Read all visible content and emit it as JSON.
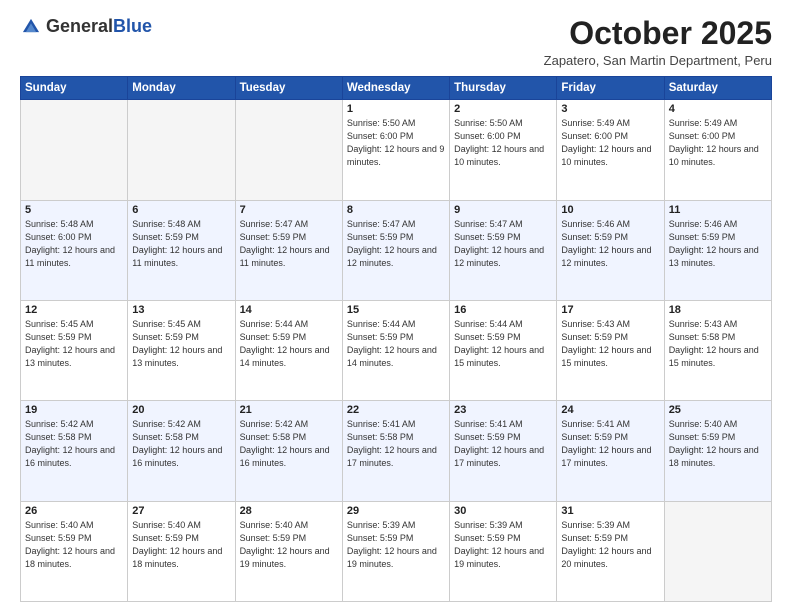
{
  "header": {
    "logo": {
      "general": "General",
      "blue": "Blue",
      "tagline": "General Blue"
    },
    "title": "October 2025",
    "subtitle": "Zapatero, San Martin Department, Peru"
  },
  "weekdays": [
    "Sunday",
    "Monday",
    "Tuesday",
    "Wednesday",
    "Thursday",
    "Friday",
    "Saturday"
  ],
  "weeks": [
    [
      {
        "day": null
      },
      {
        "day": null
      },
      {
        "day": null
      },
      {
        "day": "1",
        "sunrise": "Sunrise: 5:50 AM",
        "sunset": "Sunset: 6:00 PM",
        "daylight": "Daylight: 12 hours and 9 minutes."
      },
      {
        "day": "2",
        "sunrise": "Sunrise: 5:50 AM",
        "sunset": "Sunset: 6:00 PM",
        "daylight": "Daylight: 12 hours and 10 minutes."
      },
      {
        "day": "3",
        "sunrise": "Sunrise: 5:49 AM",
        "sunset": "Sunset: 6:00 PM",
        "daylight": "Daylight: 12 hours and 10 minutes."
      },
      {
        "day": "4",
        "sunrise": "Sunrise: 5:49 AM",
        "sunset": "Sunset: 6:00 PM",
        "daylight": "Daylight: 12 hours and 10 minutes."
      }
    ],
    [
      {
        "day": "5",
        "sunrise": "Sunrise: 5:48 AM",
        "sunset": "Sunset: 6:00 PM",
        "daylight": "Daylight: 12 hours and 11 minutes."
      },
      {
        "day": "6",
        "sunrise": "Sunrise: 5:48 AM",
        "sunset": "Sunset: 5:59 PM",
        "daylight": "Daylight: 12 hours and 11 minutes."
      },
      {
        "day": "7",
        "sunrise": "Sunrise: 5:47 AM",
        "sunset": "Sunset: 5:59 PM",
        "daylight": "Daylight: 12 hours and 11 minutes."
      },
      {
        "day": "8",
        "sunrise": "Sunrise: 5:47 AM",
        "sunset": "Sunset: 5:59 PM",
        "daylight": "Daylight: 12 hours and 12 minutes."
      },
      {
        "day": "9",
        "sunrise": "Sunrise: 5:47 AM",
        "sunset": "Sunset: 5:59 PM",
        "daylight": "Daylight: 12 hours and 12 minutes."
      },
      {
        "day": "10",
        "sunrise": "Sunrise: 5:46 AM",
        "sunset": "Sunset: 5:59 PM",
        "daylight": "Daylight: 12 hours and 12 minutes."
      },
      {
        "day": "11",
        "sunrise": "Sunrise: 5:46 AM",
        "sunset": "Sunset: 5:59 PM",
        "daylight": "Daylight: 12 hours and 13 minutes."
      }
    ],
    [
      {
        "day": "12",
        "sunrise": "Sunrise: 5:45 AM",
        "sunset": "Sunset: 5:59 PM",
        "daylight": "Daylight: 12 hours and 13 minutes."
      },
      {
        "day": "13",
        "sunrise": "Sunrise: 5:45 AM",
        "sunset": "Sunset: 5:59 PM",
        "daylight": "Daylight: 12 hours and 13 minutes."
      },
      {
        "day": "14",
        "sunrise": "Sunrise: 5:44 AM",
        "sunset": "Sunset: 5:59 PM",
        "daylight": "Daylight: 12 hours and 14 minutes."
      },
      {
        "day": "15",
        "sunrise": "Sunrise: 5:44 AM",
        "sunset": "Sunset: 5:59 PM",
        "daylight": "Daylight: 12 hours and 14 minutes."
      },
      {
        "day": "16",
        "sunrise": "Sunrise: 5:44 AM",
        "sunset": "Sunset: 5:59 PM",
        "daylight": "Daylight: 12 hours and 15 minutes."
      },
      {
        "day": "17",
        "sunrise": "Sunrise: 5:43 AM",
        "sunset": "Sunset: 5:59 PM",
        "daylight": "Daylight: 12 hours and 15 minutes."
      },
      {
        "day": "18",
        "sunrise": "Sunrise: 5:43 AM",
        "sunset": "Sunset: 5:58 PM",
        "daylight": "Daylight: 12 hours and 15 minutes."
      }
    ],
    [
      {
        "day": "19",
        "sunrise": "Sunrise: 5:42 AM",
        "sunset": "Sunset: 5:58 PM",
        "daylight": "Daylight: 12 hours and 16 minutes."
      },
      {
        "day": "20",
        "sunrise": "Sunrise: 5:42 AM",
        "sunset": "Sunset: 5:58 PM",
        "daylight": "Daylight: 12 hours and 16 minutes."
      },
      {
        "day": "21",
        "sunrise": "Sunrise: 5:42 AM",
        "sunset": "Sunset: 5:58 PM",
        "daylight": "Daylight: 12 hours and 16 minutes."
      },
      {
        "day": "22",
        "sunrise": "Sunrise: 5:41 AM",
        "sunset": "Sunset: 5:58 PM",
        "daylight": "Daylight: 12 hours and 17 minutes."
      },
      {
        "day": "23",
        "sunrise": "Sunrise: 5:41 AM",
        "sunset": "Sunset: 5:59 PM",
        "daylight": "Daylight: 12 hours and 17 minutes."
      },
      {
        "day": "24",
        "sunrise": "Sunrise: 5:41 AM",
        "sunset": "Sunset: 5:59 PM",
        "daylight": "Daylight: 12 hours and 17 minutes."
      },
      {
        "day": "25",
        "sunrise": "Sunrise: 5:40 AM",
        "sunset": "Sunset: 5:59 PM",
        "daylight": "Daylight: 12 hours and 18 minutes."
      }
    ],
    [
      {
        "day": "26",
        "sunrise": "Sunrise: 5:40 AM",
        "sunset": "Sunset: 5:59 PM",
        "daylight": "Daylight: 12 hours and 18 minutes."
      },
      {
        "day": "27",
        "sunrise": "Sunrise: 5:40 AM",
        "sunset": "Sunset: 5:59 PM",
        "daylight": "Daylight: 12 hours and 18 minutes."
      },
      {
        "day": "28",
        "sunrise": "Sunrise: 5:40 AM",
        "sunset": "Sunset: 5:59 PM",
        "daylight": "Daylight: 12 hours and 19 minutes."
      },
      {
        "day": "29",
        "sunrise": "Sunrise: 5:39 AM",
        "sunset": "Sunset: 5:59 PM",
        "daylight": "Daylight: 12 hours and 19 minutes."
      },
      {
        "day": "30",
        "sunrise": "Sunrise: 5:39 AM",
        "sunset": "Sunset: 5:59 PM",
        "daylight": "Daylight: 12 hours and 19 minutes."
      },
      {
        "day": "31",
        "sunrise": "Sunrise: 5:39 AM",
        "sunset": "Sunset: 5:59 PM",
        "daylight": "Daylight: 12 hours and 20 minutes."
      },
      {
        "day": null
      }
    ]
  ]
}
